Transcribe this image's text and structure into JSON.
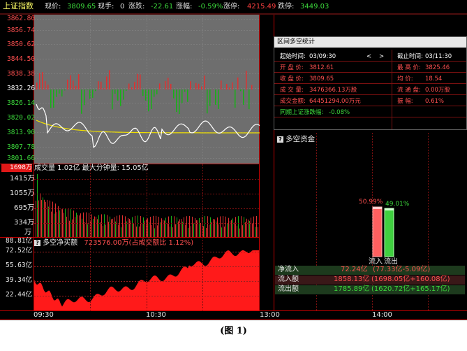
{
  "header": {
    "index_name": "上证指数",
    "price_label": "现价:",
    "price": "3809.65",
    "vol_label": "现手:",
    "vol": "0",
    "chg_label": "涨跌:",
    "chg": "-22.61",
    "pct_label": "涨幅:",
    "pct": "-0.59%",
    "limit_up_label": "涨停:",
    "limit_up": "4215.49",
    "limit_down_label": "跌停:",
    "limit_down": "3449.03"
  },
  "price_axis": [
    "3862.80",
    "3856.74",
    "3850.62",
    "3844.50",
    "3838.38",
    "3832.26",
    "3826.14",
    "3820.02",
    "3813.90",
    "3807.78",
    "3801.66"
  ],
  "volume_panel": {
    "badge": "1698万",
    "title": "成交量 1.02亿 最大分钟量: 15.05亿",
    "axis": [
      "1415万",
      "1055万",
      "695万",
      "334万",
      "万"
    ]
  },
  "net_panel": {
    "icon": "question-icon",
    "title": "多空净买额",
    "value_text": "723576.00万(占成交额比 1.12%)",
    "axis": [
      "88.81亿",
      "72.52亿",
      "55.63亿",
      "39.34亿",
      "22.44亿"
    ]
  },
  "time_axis": [
    "09:30",
    "10:30",
    "13:00",
    "14:00"
  ],
  "stat_window": {
    "title": "区间多空统计",
    "start_label": "起始时间:",
    "start": "03/09:30",
    "end_label": "截止时间:",
    "end": "03/11:30",
    "nav_prev": "<",
    "nav_next": ">",
    "rows": [
      {
        "l1": "开 盘 价:",
        "v1": "3812.61",
        "l2": "最 高 价:",
        "v2": "3825.46"
      },
      {
        "l1": "收 盘 价:",
        "v1": "3809.65",
        "l2": "均    价:",
        "v2": "18.54"
      },
      {
        "l1": "成 交 量:",
        "v1": "3476366.13万股",
        "l2": "流 通 盘:",
        "v2": "0.00万股"
      },
      {
        "l1": "成交金额:",
        "v1": "64451294.00万元",
        "l2": "振     幅:",
        "v2": "0.61%"
      }
    ],
    "sync_label": "同期上证涨跌幅:",
    "sync_value": "-0.08%"
  },
  "fund_panel": {
    "icon": "question-icon",
    "title": "多空资金",
    "inflow_pct": "50.99%",
    "outflow_pct": "49.01%",
    "inflow_share": 50.99,
    "outflow_share": 49.01,
    "inflow_label": "流入",
    "outflow_label": "流出",
    "rows": [
      {
        "label": "净流入",
        "value": "72.24亿",
        "detail": "(77.33亿-5.09亿)"
      },
      {
        "label": "流入额",
        "value": "1858.13亿",
        "detail": "(1698.05亿+160.08亿)"
      },
      {
        "label": "流出额",
        "value": "1785.89亿",
        "detail": "(1620.72亿+165.17亿)"
      }
    ]
  },
  "caption": "(图 1)",
  "colors": {
    "up": "#ff3030",
    "down": "#00c000",
    "yellow": "#f0e000",
    "axis": "#c00000",
    "chart_bg": "#6e6e6e"
  }
}
